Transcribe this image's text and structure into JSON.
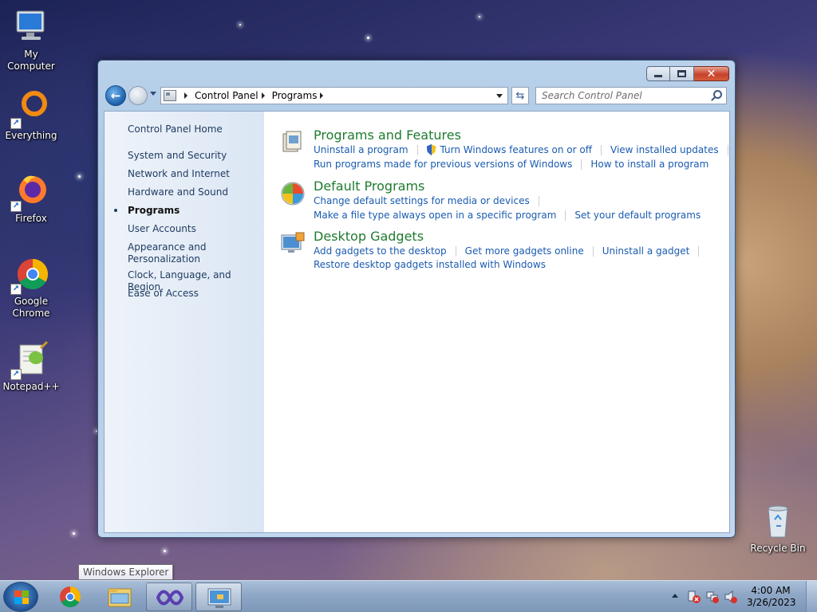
{
  "desktop": {
    "icons": [
      {
        "label": "My Computer",
        "icon": "computer-icon"
      },
      {
        "label": "Everything",
        "icon": "everything-icon"
      },
      {
        "label": "Firefox",
        "icon": "firefox-icon"
      },
      {
        "label": "Google Chrome",
        "icon": "chrome-icon"
      },
      {
        "label": "Notepad++",
        "icon": "notepadpp-icon"
      },
      {
        "label": "Recycle Bin",
        "icon": "recycle-bin-icon"
      }
    ]
  },
  "window": {
    "address": {
      "crumbs": [
        "Control Panel",
        "Programs"
      ]
    },
    "search": {
      "placeholder": "Search Control Panel"
    },
    "sidebar": {
      "items": [
        {
          "label": "Control Panel Home"
        },
        {
          "label": "System and Security"
        },
        {
          "label": "Network and Internet"
        },
        {
          "label": "Hardware and Sound"
        },
        {
          "label": "Programs",
          "active": true
        },
        {
          "label": "User Accounts"
        },
        {
          "label": "Appearance and Personalization"
        },
        {
          "label": "Clock, Language, and Region"
        },
        {
          "label": "Ease of Access"
        }
      ]
    },
    "categories": [
      {
        "title": "Programs and Features",
        "icon": "programs-features-icon",
        "row1": [
          "Uninstall a program",
          "Turn Windows features on or off",
          "View installed updates"
        ],
        "row2": [
          "Run programs made for previous versions of Windows",
          "How to install a program"
        ]
      },
      {
        "title": "Default Programs",
        "icon": "default-programs-icon",
        "row1": [
          "Change default settings for media or devices"
        ],
        "row2": [
          "Make a file type always open in a specific program",
          "Set your default programs"
        ]
      },
      {
        "title": "Desktop Gadgets",
        "icon": "desktop-gadgets-icon",
        "row1": [
          "Add gadgets to the desktop",
          "Get more gadgets online",
          "Uninstall a gadget"
        ],
        "row2": [
          "Restore desktop gadgets installed with Windows"
        ]
      }
    ]
  },
  "tooltip": {
    "text": "Windows Explorer"
  },
  "taskbar": {
    "apps": [
      "chrome-icon",
      "windows-explorer-icon",
      "visual-studio-icon",
      "control-panel-icon"
    ],
    "clock": {
      "time": "4:00 AM",
      "date": "3/26/2023"
    }
  },
  "colors": {
    "link": "#1a5bb0",
    "category_title": "#1e7b2e",
    "close_button": "#c7432a"
  }
}
